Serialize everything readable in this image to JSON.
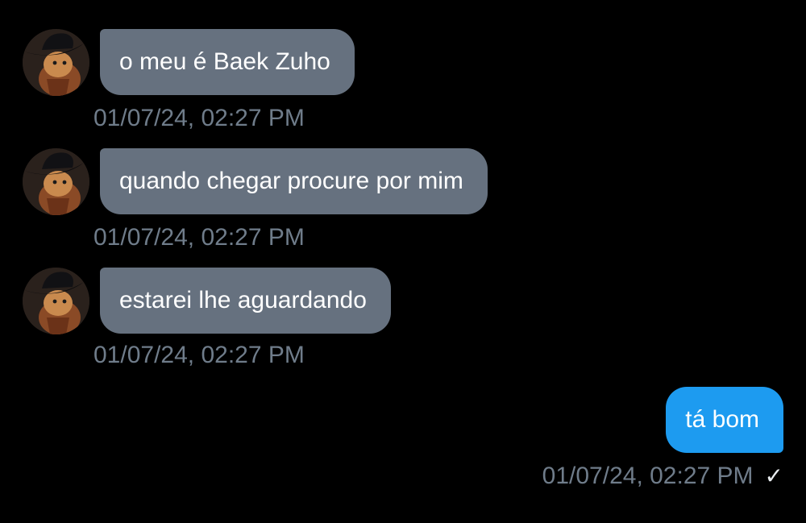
{
  "colors": {
    "background": "#000000",
    "incoming_bubble": "#66717f",
    "outgoing_bubble": "#1d9bf0",
    "timestamp": "#6f7c8a",
    "text": "#ffffff"
  },
  "messages": [
    {
      "direction": "incoming",
      "avatar": "cat-avatar",
      "text": "o meu é Baek Zuho",
      "timestamp": "01/07/24, 02:27 PM"
    },
    {
      "direction": "incoming",
      "avatar": "cat-avatar",
      "text": "quando chegar procure por mim",
      "timestamp": "01/07/24, 02:27 PM"
    },
    {
      "direction": "incoming",
      "avatar": "cat-avatar",
      "text": "estarei lhe aguardando",
      "timestamp": "01/07/24, 02:27 PM"
    },
    {
      "direction": "outgoing",
      "text": "tá bom",
      "timestamp": "01/07/24, 02:27 PM",
      "status_icon": "checkmark-icon"
    }
  ]
}
